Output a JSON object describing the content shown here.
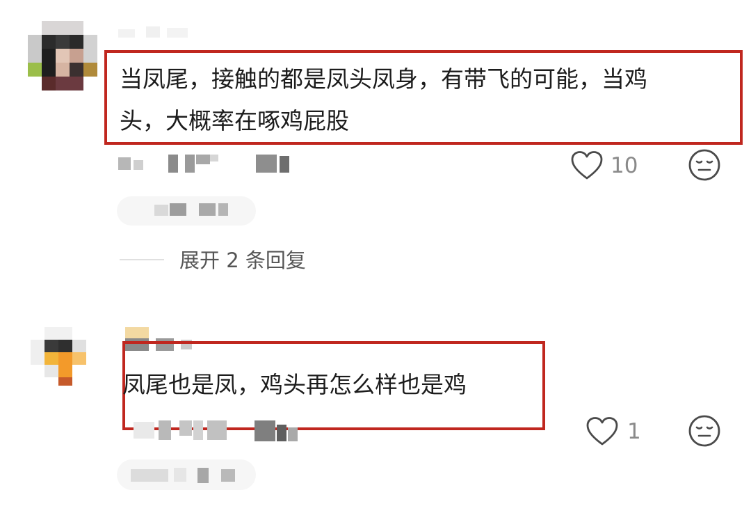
{
  "comments": [
    {
      "text_line1": "当凤尾，接触的都是凤头凤身，有带飞的可能，当鸡",
      "text_line2": "头，大概率在啄鸡屁股",
      "likes": "10",
      "expand_replies": "展开 2 条回复"
    },
    {
      "text_line1": "凤尾也是凤，鸡头再怎么样也是鸡",
      "likes": "1"
    }
  ],
  "icons": {
    "like": "heart-outline-icon",
    "reaction": "neutral-face-icon"
  },
  "colors": {
    "highlight": "#c0271f",
    "meta_text": "#8a8a8a"
  }
}
